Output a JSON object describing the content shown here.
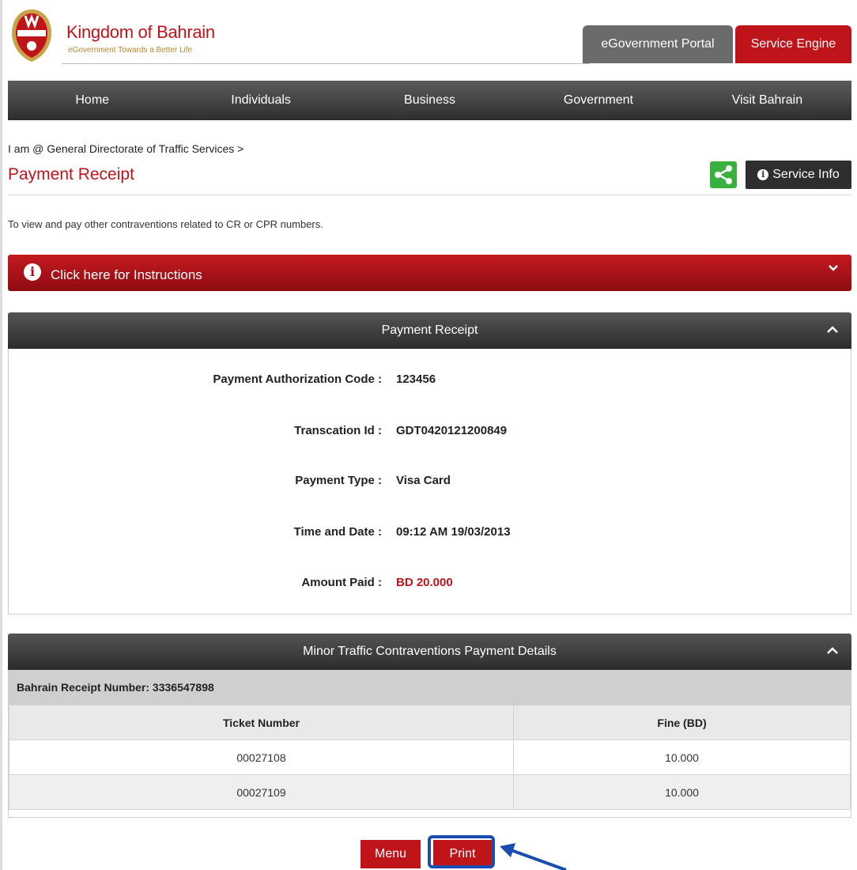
{
  "header": {
    "brand_title": "Kingdom of Bahrain",
    "brand_tagline": "eGovernment Towards a Better Life",
    "portal_button": "eGovernment Portal",
    "engine_button": "Service Engine"
  },
  "nav": {
    "items": [
      {
        "label": "Home"
      },
      {
        "label": "Individuals"
      },
      {
        "label": "Business"
      },
      {
        "label": "Government"
      },
      {
        "label": "Visit Bahrain"
      }
    ]
  },
  "breadcrumb": "I am @ General Directorate of Traffic Services >",
  "page_title": "Payment Receipt",
  "service_info_label": "Service Info",
  "description": "To view and pay other contraventions related to CR or CPR numbers.",
  "instructions": {
    "icon_glyph": "i",
    "label": "Click here for Instructions"
  },
  "receipt_panel": {
    "title": "Payment Receipt",
    "rows": [
      {
        "label": "Payment Authorization Code :",
        "value": "123456"
      },
      {
        "label": "Transcation Id :",
        "value": "GDT0420121200849"
      },
      {
        "label": "Payment Type :",
        "value": "Visa Card"
      },
      {
        "label": "Time and Date :",
        "value": "09:12 AM 19/03/2013"
      },
      {
        "label": "Amount Paid :",
        "value": "BD 20.000"
      }
    ]
  },
  "details_panel": {
    "title": "Minor Traffic Contraventions Payment Details",
    "receipt_number": "Bahrain Receipt Number: 3336547898",
    "columns": [
      "Ticket Number",
      "Fine (BD)"
    ],
    "rows": [
      {
        "ticket": "00027108",
        "fine": "10.000"
      },
      {
        "ticket": "00027109",
        "fine": "10.000"
      }
    ]
  },
  "buttons": {
    "menu": "Menu",
    "print": "Print"
  },
  "colors": {
    "brand_red": "#c0141b",
    "nav_dark": "#2e2e2e",
    "share_green": "#3ab03e",
    "annotation_blue": "#1a4db0"
  }
}
